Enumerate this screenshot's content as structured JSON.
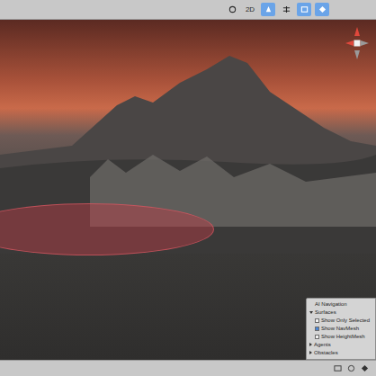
{
  "toolbar": {
    "view_mode": {
      "label": "2D",
      "selected": false
    },
    "tools": [
      {
        "selected": false
      },
      {
        "selected": true
      },
      {
        "selected": false
      },
      {
        "selected": true
      },
      {
        "selected": true
      }
    ]
  },
  "scene": {
    "navmesh_visible": true
  },
  "overlay": {
    "title": "AI Navigation",
    "sections": [
      {
        "label": "Surfaces",
        "expanded": true,
        "options": [
          {
            "label": "Show Only Selected",
            "checked": false
          },
          {
            "label": "Show NavMesh",
            "checked": true
          },
          {
            "label": "Show HeightMesh",
            "checked": false
          }
        ]
      },
      {
        "label": "Agents",
        "expanded": false,
        "options": []
      },
      {
        "label": "Obstacles",
        "expanded": false,
        "options": []
      }
    ]
  }
}
